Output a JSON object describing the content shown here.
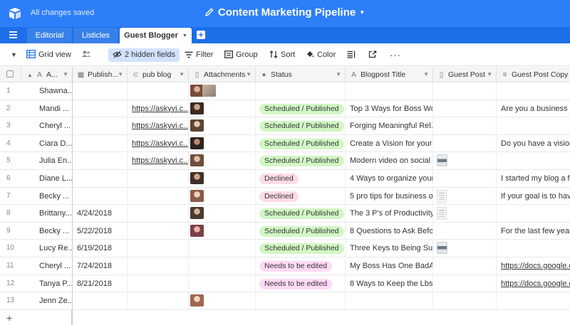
{
  "app": {
    "save_status": "All changes saved",
    "base_name": "Content Marketing Pipeline",
    "colors": {
      "topbar": "#2d7ff9",
      "tabbar": "#1c6fe8",
      "green": "#d1f7c4",
      "red": "#ffdce5",
      "pink": "#ffdaf6"
    }
  },
  "tabs": [
    {
      "label": "Editorial",
      "active": false
    },
    {
      "label": "Listicles",
      "active": false
    },
    {
      "label": "Guest Blogger",
      "active": true
    }
  ],
  "viewbar": {
    "view_name": "Grid view",
    "hidden_fields": "2 hidden fields",
    "filter": "Filter",
    "group": "Group",
    "sort": "Sort",
    "color": "Color"
  },
  "columns": [
    {
      "label": "A...",
      "icon": "text-icon"
    },
    {
      "label": "Publish...",
      "icon": "calendar-icon"
    },
    {
      "label": "pub blog",
      "icon": "link-icon"
    },
    {
      "label": "Attachments",
      "icon": "attachment-icon"
    },
    {
      "label": "Status",
      "icon": "single-select-icon"
    },
    {
      "label": "Blogpost Title",
      "icon": "text-icon"
    },
    {
      "label": "Guest Post",
      "icon": "attachment-icon"
    },
    {
      "label": "Guest Post Copy",
      "icon": "long-text-icon"
    }
  ],
  "rows": [
    {
      "num": "1",
      "author": "Shawna...",
      "publish": "",
      "pub_blog": "",
      "attachments": 2,
      "status": "",
      "status_color": "",
      "title": "",
      "guest_post": "",
      "copy": ""
    },
    {
      "num": "2",
      "author": "Mandi ...",
      "publish": "",
      "pub_blog": "https://askyvi.c...",
      "attachments": 1,
      "status": "Scheduled / Published",
      "status_color": "green",
      "title": "Top 3 Ways for Boss Wo...",
      "guest_post": "",
      "copy": "Are you a business ow"
    },
    {
      "num": "3",
      "author": "Cheryl ...",
      "publish": "",
      "pub_blog": "https://askyvi.c...",
      "attachments": 1,
      "status": "Scheduled / Published",
      "status_color": "green",
      "title": "Forging Meaningful Rel...",
      "guest_post": "",
      "copy": ""
    },
    {
      "num": "4",
      "author": "Ciara D...",
      "publish": "",
      "pub_blog": "https://askyvi.c...",
      "attachments": 1,
      "status": "Scheduled / Published",
      "status_color": "green",
      "title": "Create a Vision for your ...",
      "guest_post": "",
      "copy": "Do you have a vision fo"
    },
    {
      "num": "5",
      "author": "Julia En...",
      "publish": "",
      "pub_blog": "https://askyvi.c...",
      "attachments": 1,
      "status": "Scheduled / Published",
      "status_color": "green",
      "title": "Modern video on social ...",
      "guest_post": "image",
      "copy": ""
    },
    {
      "num": "6",
      "author": "Diane L...",
      "publish": "",
      "pub_blog": "",
      "attachments": 1,
      "status": "Declined",
      "status_color": "red",
      "title": "4 Ways to organize your...",
      "guest_post": "",
      "copy": "I started my blog a few"
    },
    {
      "num": "7",
      "author": "Becky ...",
      "publish": "",
      "pub_blog": "",
      "attachments": 1,
      "status": "Declined",
      "status_color": "red",
      "title": "5 pro tips for business o...",
      "guest_post": "doc",
      "copy": "If your goal is to have y"
    },
    {
      "num": "8",
      "author": "Brittany...",
      "publish": "4/24/2018",
      "pub_blog": "",
      "attachments": 1,
      "status": "Scheduled / Published",
      "status_color": "green",
      "title": "The 3 P's of Productivity",
      "guest_post": "doc",
      "copy": ""
    },
    {
      "num": "9",
      "author": "Becky ...",
      "publish": "5/22/2018",
      "pub_blog": "",
      "attachments": 1,
      "status": "Scheduled / Published",
      "status_color": "green",
      "title": "8 Questions to Ask Befo...",
      "guest_post": "",
      "copy": "For the last few years, I"
    },
    {
      "num": "10",
      "author": "Lucy Re...",
      "publish": "6/19/2018",
      "pub_blog": "",
      "attachments": 0,
      "status": "Scheduled / Published",
      "status_color": "green",
      "title": "Three Keys to Being Suc...",
      "guest_post": "image",
      "copy": ""
    },
    {
      "num": "11",
      "author": "Cheryl ...",
      "publish": "7/24/2018",
      "pub_blog": "",
      "attachments": 0,
      "status": "Needs to be edited",
      "status_color": "pink",
      "title": "My Boss Has One BadA...",
      "guest_post": "",
      "copy": "https://docs.google.co"
    },
    {
      "num": "12",
      "author": "Tanya P...",
      "publish": "8/21/2018",
      "pub_blog": "",
      "attachments": 0,
      "status": "Needs to be edited",
      "status_color": "pink",
      "title": "8 Ways to Keep the Lbs ...",
      "guest_post": "",
      "copy": "https://docs.google.co"
    },
    {
      "num": "13",
      "author": "Jenn Ze...",
      "publish": "",
      "pub_blog": "",
      "attachments": 1,
      "status": "",
      "status_color": "",
      "title": "",
      "guest_post": "",
      "copy": ""
    }
  ]
}
